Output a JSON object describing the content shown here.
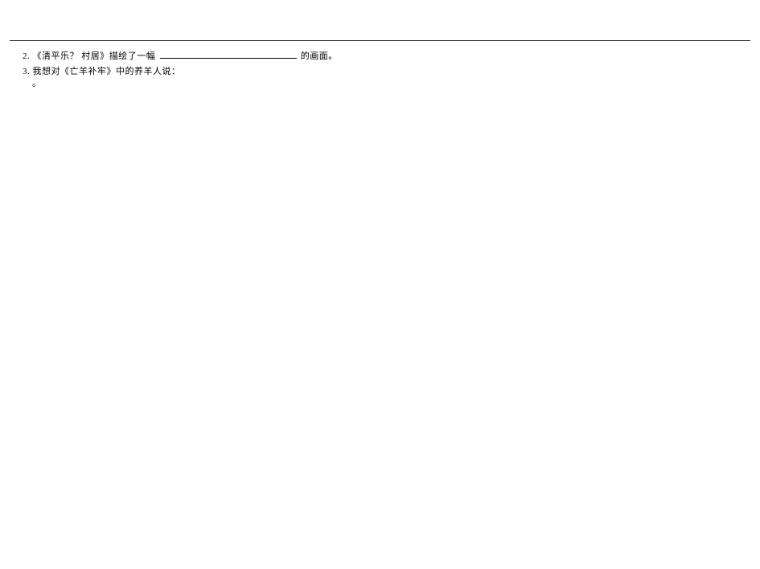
{
  "question2": {
    "number": "2.",
    "text_before": "《清平乐",
    "question_mark": "？",
    "text_mid": " 村居》描绘了一幅",
    "text_after": " 的画面。"
  },
  "question3": {
    "number": "3.",
    "text": "我想对《亡羊补牢》中的养羊人说：",
    "continuation": "。"
  }
}
